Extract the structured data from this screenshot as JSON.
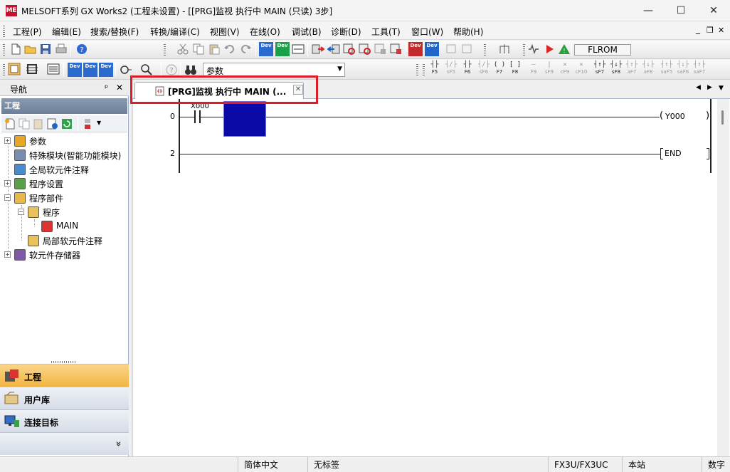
{
  "window": {
    "title": "MELSOFT系列 GX Works2 (工程未设置) - [[PRG]监视 执行中 MAIN (只读) 3步]",
    "app_icon_text": "ME",
    "minimize_glyph": "—",
    "maximize_glyph": "☐",
    "close_glyph": "✕"
  },
  "menu": {
    "items": [
      "工程(P)",
      "编辑(E)",
      "搜索/替换(F)",
      "转换/编译(C)",
      "视图(V)",
      "在线(O)",
      "调试(B)",
      "诊断(D)",
      "工具(T)",
      "窗口(W)",
      "帮助(H)"
    ],
    "mdi_min": "_",
    "mdi_restore": "❐",
    "mdi_close": "✕"
  },
  "toolbar": {
    "dev_label": "Dev",
    "flrom_label": "FLROM",
    "parameter_combo_value": "参数",
    "fkeys": [
      {
        "sym": "┤├",
        "label": "F5",
        "enabled": true
      },
      {
        "sym": "┤/├",
        "label": "sF5",
        "enabled": false
      },
      {
        "sym": "┤├",
        "label": "F6",
        "enabled": true
      },
      {
        "sym": "┤/├",
        "label": "sF6",
        "enabled": false
      },
      {
        "sym": "( )",
        "label": "F7",
        "enabled": true
      },
      {
        "sym": "[ ]",
        "label": "F8",
        "enabled": true
      },
      {
        "sym": "—",
        "label": "F9",
        "enabled": false
      },
      {
        "sym": "|",
        "label": "sF9",
        "enabled": false
      },
      {
        "sym": "✕",
        "label": "cF9",
        "enabled": false
      },
      {
        "sym": "✕",
        "label": "cF10",
        "enabled": false
      },
      {
        "sym": "┤↑├",
        "label": "sF7",
        "enabled": true
      },
      {
        "sym": "┤↓├",
        "label": "sF8",
        "enabled": true
      },
      {
        "sym": "┤↑├",
        "label": "aF7",
        "enabled": false
      },
      {
        "sym": "┤↓├",
        "label": "aF8",
        "enabled": false
      },
      {
        "sym": "┤↑├",
        "label": "saF5",
        "enabled": false
      },
      {
        "sym": "┤↓├",
        "label": "saF6",
        "enabled": false
      },
      {
        "sym": "┤↑├",
        "label": "saF7",
        "enabled": false
      }
    ]
  },
  "navigation": {
    "title": "导航",
    "pin_glyph": "ᵖ",
    "close_glyph": "✕",
    "project_header": "工程",
    "tree": [
      {
        "label": "参数",
        "level": 0,
        "expander": "+"
      },
      {
        "label": "特殊模块(智能功能模块)",
        "level": 0,
        "expander": ""
      },
      {
        "label": "全局软元件注释",
        "level": 0,
        "expander": ""
      },
      {
        "label": "程序设置",
        "level": 0,
        "expander": "+"
      },
      {
        "label": "程序部件",
        "level": 0,
        "expander": "−"
      },
      {
        "label": "程序",
        "level": 1,
        "expander": "−"
      },
      {
        "label": "MAIN",
        "level": 2,
        "expander": ""
      },
      {
        "label": "局部软元件注释",
        "level": 1,
        "expander": ""
      },
      {
        "label": "软元件存储器",
        "level": 0,
        "expander": "+"
      }
    ],
    "bottom_tabs": [
      {
        "label": "工程",
        "active": true
      },
      {
        "label": "用户库",
        "active": false
      },
      {
        "label": "连接目标",
        "active": false
      }
    ],
    "more_glyph": "»"
  },
  "editor_tab": {
    "label": "[PRG]监视 执行中 MAIN (...",
    "close_glyph": "✕",
    "nav_prev": "◀",
    "nav_next": "▶",
    "nav_menu": "▼"
  },
  "ladder": {
    "rungs": [
      {
        "step": "0",
        "contact": "X000",
        "coil": "Y000"
      },
      {
        "step": "2",
        "instruction": "END"
      }
    ]
  },
  "status": {
    "cells": [
      "简体中文",
      "无标签",
      "FX3U/FX3UC",
      "本站",
      "数字"
    ]
  },
  "colors": {
    "monitor_cursor": "#0a0aa8",
    "highlight_box": "#d9202a",
    "active_nav_tab": "#f7c35f"
  }
}
